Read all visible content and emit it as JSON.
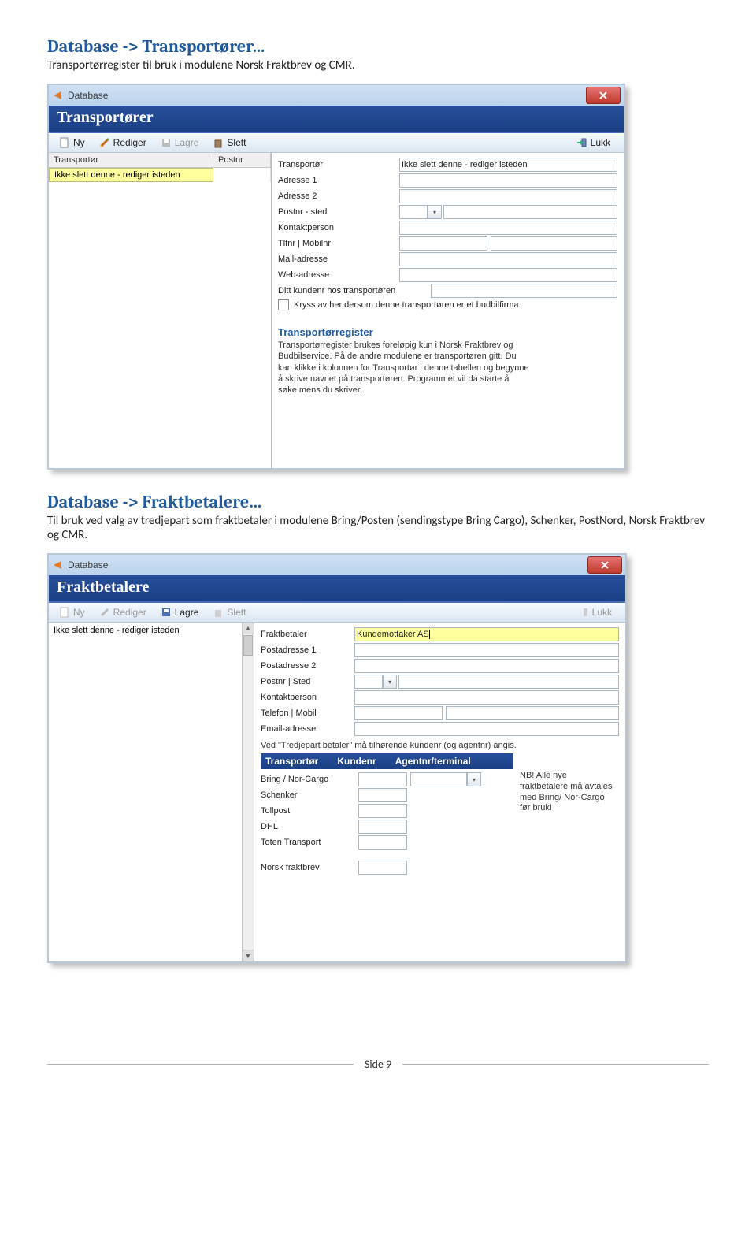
{
  "headings": {
    "h1": "Database -> Transportører…",
    "p1": "Transportørregister til bruk i modulene Norsk Fraktbrev og CMR.",
    "h2": "Database -> Fraktbetalere…",
    "p2": "Til bruk ved valg av tredjepart som fraktbetaler i modulene  Bring/Posten (sendingstype Bring Cargo), Schenker, PostNord, Norsk Fraktbrev og CMR."
  },
  "toolbar": {
    "ny": "Ny",
    "rediger": "Rediger",
    "lagre": "Lagre",
    "slett": "Slett",
    "lukk": "Lukk"
  },
  "win1": {
    "titlebar": "Database",
    "blue_title": "Transportører",
    "grid": {
      "col1": "Transportør",
      "col2": "Postnr",
      "row1": "Ikke slett denne - rediger isteden"
    },
    "fields": {
      "transportor": "Transportør",
      "transportor_val": "Ikke slett denne - rediger isteden",
      "adresse1": "Adresse 1",
      "adresse2": "Adresse 2",
      "postnr_sted": "Postnr - sted",
      "kontakt": "Kontaktperson",
      "tlfnr": "Tlfnr | Mobilnr",
      "mail": "Mail-adresse",
      "web": "Web-adresse",
      "kundenr": "Ditt kundenr hos transportøren",
      "check": "Kryss av her dersom denne transportøren er et budbilfirma"
    },
    "info": {
      "title": "Transportørregister",
      "body": "Transportørregister brukes foreløpig kun i Norsk Fraktbrev og Budbilservice. På de andre modulene er transportøren gitt. Du kan klikke i kolonnen for Transportør i denne tabellen og begynne å skrive navnet på transportøren. Programmet vil da starte å søke mens du skriver."
    }
  },
  "win2": {
    "titlebar": "Database",
    "blue_title": "Fraktbetalere",
    "list_item": "Ikke slett denne - rediger isteden",
    "fields": {
      "fraktbetaler": "Fraktbetaler",
      "fraktbetaler_val": "Kundemottaker AS",
      "post1": "Postadresse 1",
      "post2": "Postadresse 2",
      "postnr_sted": "Postnr | Sted",
      "kontakt": "Kontaktperson",
      "tel": "Telefon | Mobil",
      "email": "Email-adresse"
    },
    "note": "Ved \"Tredjepart betaler\" må tilhørende kundenr (og agentnr) angis.",
    "trans_hdr": {
      "c1": "Transportør",
      "c2": "Kundenr",
      "c3": "Agentnr/terminal"
    },
    "payers": [
      "Bring / Nor-Cargo",
      "Schenker",
      "Tollpost",
      "DHL",
      "Toten Transport",
      "Norsk fraktbrev"
    ],
    "nb": "NB! Alle nye fraktbetalere må avtales med Bring/ Nor-Cargo før bruk!"
  },
  "footer": "Side 9"
}
